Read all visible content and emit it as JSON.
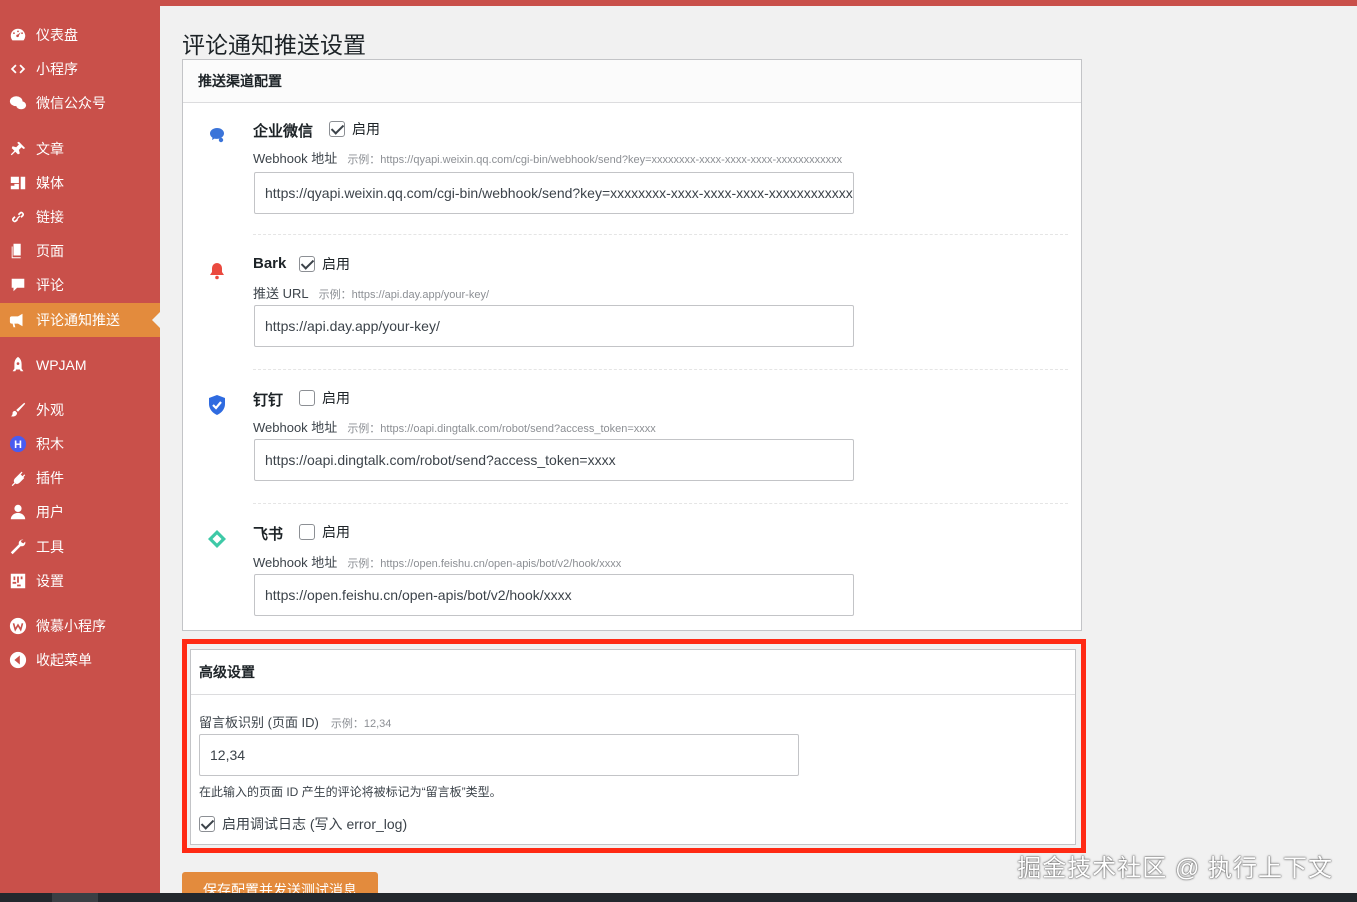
{
  "sidebar": {
    "items": [
      {
        "label": "仪表盘",
        "icon": "dashboard-icon"
      },
      {
        "label": "小程序",
        "icon": "code-icon"
      },
      {
        "label": "微信公众号",
        "icon": "wechat-icon"
      },
      {
        "label": "文章",
        "icon": "pin-icon"
      },
      {
        "label": "媒体",
        "icon": "media-icon"
      },
      {
        "label": "链接",
        "icon": "link-icon"
      },
      {
        "label": "页面",
        "icon": "page-icon"
      },
      {
        "label": "评论",
        "icon": "comment-icon"
      },
      {
        "label": "评论通知推送",
        "icon": "megaphone-icon",
        "active": true
      },
      {
        "label": "WPJAM",
        "icon": "rocket-icon"
      },
      {
        "label": "外观",
        "icon": "brush-icon"
      },
      {
        "label": "积木",
        "icon": "blocks-icon"
      },
      {
        "label": "插件",
        "icon": "plugin-icon"
      },
      {
        "label": "用户",
        "icon": "user-icon"
      },
      {
        "label": "工具",
        "icon": "wrench-icon"
      },
      {
        "label": "设置",
        "icon": "settings-icon"
      },
      {
        "label": "微慕小程序",
        "icon": "weimu-icon"
      },
      {
        "label": "收起菜单",
        "icon": "collapse-icon"
      }
    ]
  },
  "page": {
    "title": "评论通知推送设置"
  },
  "channels_panel": {
    "heading": "推送渠道配置",
    "channels": [
      {
        "name": "企业微信",
        "icon": "wecom-icon",
        "enabled": true,
        "enable_label": "启用",
        "field_label": "Webhook 地址",
        "example": "示例：https://qyapi.weixin.qq.com/cgi-bin/webhook/send?key=xxxxxxxx-xxxx-xxxx-xxxx-xxxxxxxxxxxx",
        "value": "https://qyapi.weixin.qq.com/cgi-bin/webhook/send?key=xxxxxxxx-xxxx-xxxx-xxxx-xxxxxxxxxxxx"
      },
      {
        "name": "Bark",
        "icon": "bell-icon",
        "enabled": true,
        "enable_label": "启用",
        "field_label": "推送 URL",
        "example": "示例：https://api.day.app/your-key/",
        "value": "https://api.day.app/your-key/"
      },
      {
        "name": "钉钉",
        "icon": "dingtalk-shield-icon",
        "enabled": false,
        "enable_label": "启用",
        "field_label": "Webhook 地址",
        "example": "示例：https://oapi.dingtalk.com/robot/send?access_token=xxxx",
        "value": "https://oapi.dingtalk.com/robot/send?access_token=xxxx"
      },
      {
        "name": "飞书",
        "icon": "feishu-diamond-icon",
        "enabled": false,
        "enable_label": "启用",
        "field_label": "Webhook 地址",
        "example": "示例：https://open.feishu.cn/open-apis/bot/v2/hook/xxxx",
        "value": "https://open.feishu.cn/open-apis/bot/v2/hook/xxxx"
      }
    ]
  },
  "advanced": {
    "heading": "高级设置",
    "board_label": "留言板识别 (页面 ID)",
    "board_example": "示例：12,34",
    "board_value": "12,34",
    "board_help": "在此输入的页面 ID 产生的评论将被标记为“留言板”类型。",
    "debug_label": "启用调试日志 (写入 error_log)",
    "debug_enabled": true
  },
  "save_button": "保存配置并发送测试消息",
  "watermark": "掘金技术社区 @ 执行上下文",
  "colors": {
    "sidebar": "#c9504a",
    "active": "#e38b3d",
    "highlight_border": "#ff2a14"
  }
}
